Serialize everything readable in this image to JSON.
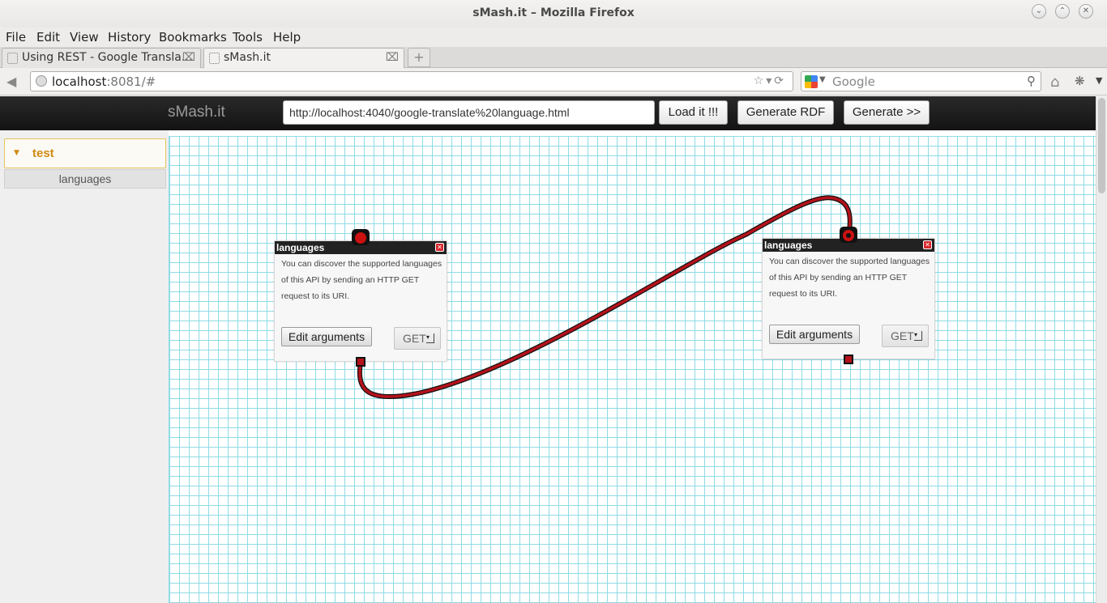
{
  "window": {
    "title": "sMash.it – Mozilla Firefox"
  },
  "menu": {
    "file": "File",
    "edit": "Edit",
    "view": "View",
    "history": "History",
    "bookmarks": "Bookmarks",
    "tools": "Tools",
    "help": "Help"
  },
  "tabs": [
    {
      "label": "Using REST - Google Transla..."
    },
    {
      "label": "sMash.it"
    }
  ],
  "nav": {
    "url_host": "localhost",
    "url_rest": ":8081/#",
    "search_placeholder": "Google"
  },
  "app": {
    "brand": "sMash.it",
    "url_value": "http://localhost:4040/google-translate%20language.html",
    "load_label": "Load it !!!",
    "rdf_label": "Generate RDF",
    "generate_label": "Generate >>"
  },
  "sidebar": {
    "group_label": "test",
    "items": [
      {
        "label": "languages"
      }
    ]
  },
  "modules": [
    {
      "title": "languages",
      "description": "You can discover the supported languages of this API by sending an HTTP GET request to its URI.",
      "edit_label": "Edit arguments",
      "method": "GET"
    },
    {
      "title": "languages",
      "description": "You can discover the supported languages of this API by sending an HTTP GET request to its URI.",
      "edit_label": "Edit arguments",
      "method": "GET"
    }
  ],
  "colors": {
    "wire": "#b5121b",
    "grid": "#8fdbe6",
    "accent": "#d08a12"
  }
}
